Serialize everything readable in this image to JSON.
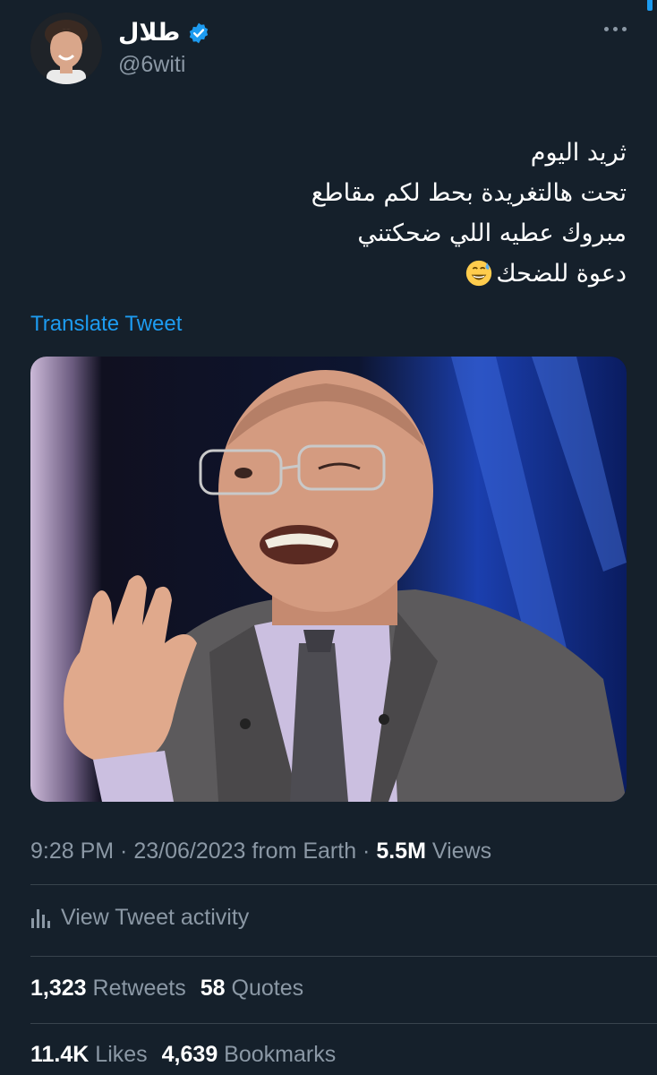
{
  "user": {
    "display_name": "طلال",
    "handle": "@6witi",
    "verified": true
  },
  "tweet": {
    "lines": [
      "ثريد اليوم",
      "تحت هالتغريدة بحط لكم مقاطع",
      "مبروك عطيه اللي ضحكتني",
      "دعوة للضحك"
    ],
    "emoji": "grinning-face-with-sweat-emoji",
    "translate_label": "Translate Tweet"
  },
  "meta": {
    "time": "9:28 PM",
    "sep1": " · ",
    "date": "23/06/2023",
    "source": " from Earth",
    "sep2": " · ",
    "views_count": "5.5M",
    "views_label": " Views"
  },
  "activity": {
    "label": "View Tweet activity"
  },
  "stats": {
    "retweets_count": "1,323",
    "retweets_label": " Retweets",
    "quotes_count": "58",
    "quotes_label": " Quotes",
    "likes_count": "11.4K",
    "likes_label": " Likes",
    "bookmarks_count": "4,639",
    "bookmarks_label": " Bookmarks"
  },
  "colors": {
    "background": "#15202b",
    "accent": "#1d9bf0",
    "secondary_text": "#8b98a5",
    "divider": "#38444d"
  }
}
